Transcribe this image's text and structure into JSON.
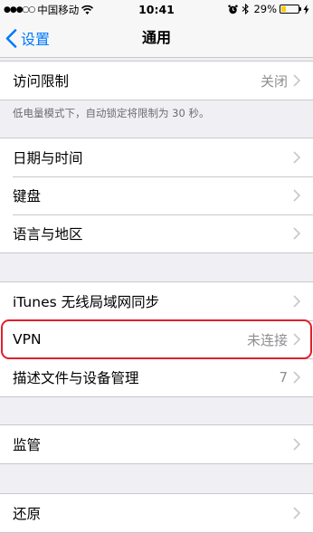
{
  "status_bar": {
    "signal": "●●●○○",
    "carrier": "中国移动",
    "time": "10:41",
    "battery": "29%"
  },
  "nav": {
    "back_label": "设置",
    "title": "通用"
  },
  "sections": {
    "restrictions": {
      "label": "访问限制",
      "value": "关闭"
    },
    "footnote": "低电量模式下，自动锁定将限制为 30 秒。",
    "datetime": {
      "label": "日期与时间"
    },
    "keyboard": {
      "label": "键盘"
    },
    "language": {
      "label": "语言与地区"
    },
    "itunes": {
      "label": "iTunes 无线局域网同步"
    },
    "vpn": {
      "label": "VPN",
      "value": "未连接"
    },
    "profiles": {
      "label": "描述文件与设备管理",
      "value": "7"
    },
    "supervision": {
      "label": "监管"
    },
    "reset": {
      "label": "还原"
    }
  },
  "colors": {
    "accent": "#007aff",
    "highlight": "#e0202c",
    "battery": "#ffcc00"
  }
}
